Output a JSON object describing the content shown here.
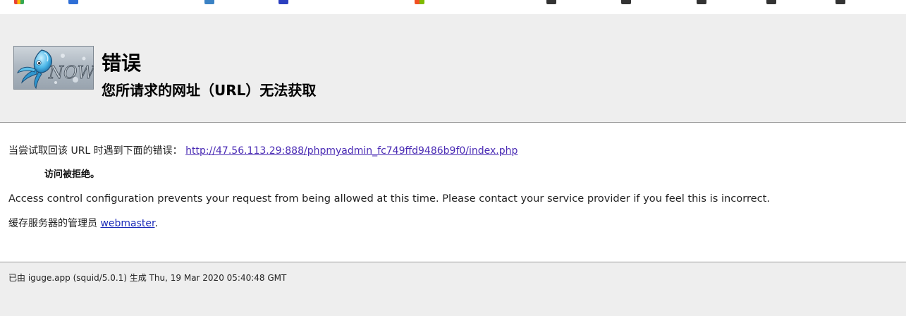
{
  "page": {
    "title": "错误",
    "subtitle": "您所请求的网址（URL）无法获取"
  },
  "logo": {
    "text": "NOW"
  },
  "error": {
    "prefix": "当尝试取回该 URL 时遇到下面的错误：",
    "url": "http://47.56.113.29:888/phpmyadmin_fc749ffd9486b9f0/index.php",
    "reason": "访问被拒绝。",
    "description": "Access control configuration prevents your request from being allowed at this time. Please contact your service provider if you feel this is incorrect.",
    "admin_prefix": "缓存服务器的管理员",
    "admin_link": "webmaster",
    "admin_suffix": "."
  },
  "footer": {
    "generated": "已由 iguge.app (squid/5.0.1) 生成 Thu, 19 Mar 2020 05:40:48 GMT"
  },
  "colors": {
    "header_bg": "#eeeeee",
    "link": "#4a2bb4",
    "webmaster_link": "#1a2ab8"
  }
}
